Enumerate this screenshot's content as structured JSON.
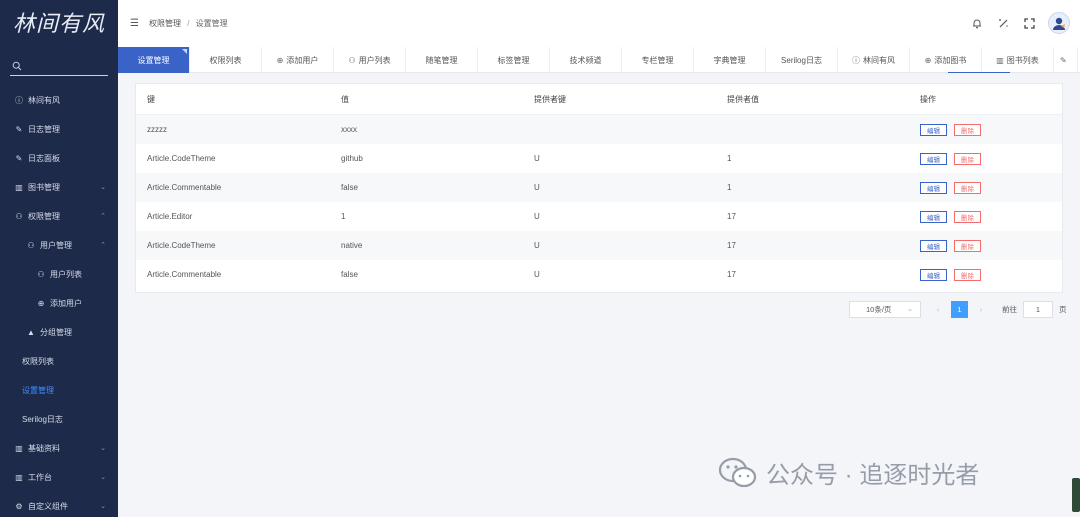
{
  "sidebar": {
    "logo": "林间有风",
    "menu": [
      {
        "label": "林间有风",
        "icon": "info-icon"
      },
      {
        "label": "日志管理",
        "icon": "edit-icon"
      },
      {
        "label": "日志面板",
        "icon": "edit-icon"
      },
      {
        "label": "图书管理",
        "icon": "book-icon",
        "expandable": true
      },
      {
        "label": "权限管理",
        "icon": "user-lock-icon",
        "expandable": true,
        "expanded": true
      },
      {
        "label": "用户管理",
        "icon": "user-lock-icon",
        "expandable": true,
        "expanded": true
      },
      {
        "label": "用户列表",
        "icon": "user-lock-icon"
      },
      {
        "label": "添加用户",
        "icon": "plus-circle-icon"
      },
      {
        "label": "分组管理",
        "icon": "group-icon"
      },
      {
        "label": "权限列表"
      },
      {
        "label": "设置管理",
        "active": true
      },
      {
        "label": "Serilog日志"
      },
      {
        "label": "基础资料",
        "icon": "book-icon",
        "expandable": true
      },
      {
        "label": "工作台",
        "icon": "book-icon",
        "expandable": true
      },
      {
        "label": "自定义组件",
        "icon": "gear-icon",
        "expandable": true
      }
    ]
  },
  "header": {
    "breadcrumb_parent": "权限管理",
    "breadcrumb_sep": "/",
    "breadcrumb_current": "设置管理"
  },
  "tabs": [
    {
      "label": "设置管理",
      "active": true
    },
    {
      "label": "权限列表"
    },
    {
      "label": "添加用户",
      "icon": "plus-circle-icon"
    },
    {
      "label": "用户列表",
      "icon": "user-lock-icon"
    },
    {
      "label": "随笔管理"
    },
    {
      "label": "标签管理"
    },
    {
      "label": "技术频道"
    },
    {
      "label": "专栏管理"
    },
    {
      "label": "字典管理"
    },
    {
      "label": "Serilog日志"
    },
    {
      "label": "林间有风",
      "icon": "info-icon"
    },
    {
      "label": "添加图书",
      "icon": "plus-circle-icon"
    },
    {
      "label": "图书列表",
      "icon": "book-icon"
    },
    {
      "label": "",
      "icon": "edit-icon"
    }
  ],
  "table": {
    "columns": [
      "键",
      "值",
      "提供者键",
      "提供者值",
      "操作"
    ],
    "rows": [
      {
        "key": "zzzzz",
        "value": "xxxx",
        "provider_key": "",
        "provider_value": ""
      },
      {
        "key": "Article.CodeTheme",
        "value": "github",
        "provider_key": "U",
        "provider_value": "1"
      },
      {
        "key": "Article.Commentable",
        "value": "false",
        "provider_key": "U",
        "provider_value": "1"
      },
      {
        "key": "Article.Editor",
        "value": "1",
        "provider_key": "U",
        "provider_value": "17"
      },
      {
        "key": "Article.CodeTheme",
        "value": "native",
        "provider_key": "U",
        "provider_value": "17"
      },
      {
        "key": "Article.Commentable",
        "value": "false",
        "provider_key": "U",
        "provider_value": "17"
      }
    ],
    "edit_label": "编辑",
    "delete_label": "删除"
  },
  "pagination": {
    "page_size": "10条/页",
    "current_page": "1",
    "goto_label": "前往",
    "goto_value": "1",
    "page_unit": "页"
  },
  "watermark": {
    "text": "公众号 · 追逐时光者"
  },
  "colors": {
    "sidebar_bg": "#1e2a4a",
    "accent": "#3a63c7",
    "active_page": "#409eff",
    "danger": "#f56c6c"
  }
}
